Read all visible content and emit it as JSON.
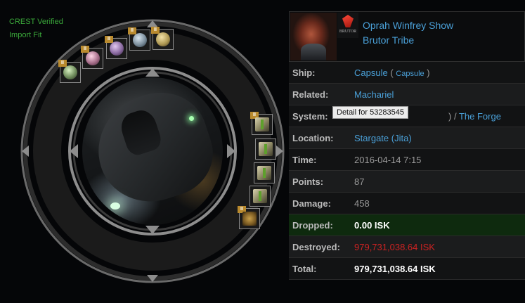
{
  "crest": {
    "verified": "CREST Verified",
    "import_fit": "Import Fit"
  },
  "victim": {
    "name": "Oprah Winfrey Show",
    "corp": "Brutor Tribe",
    "corp_logo_text": "BRUTOR"
  },
  "details": {
    "ship_label": "Ship:",
    "ship_name": "Capsule",
    "ship_group": "Capsule",
    "ship_group_open": " ( ",
    "ship_group_close": " )",
    "related_label": "Related:",
    "related_value": "Machariel",
    "system_label": "System:",
    "system_hidden_suffix": ")",
    "system_sep": " / ",
    "system_region": "The Forge",
    "location_label": "Location:",
    "location_value": "Stargate (Jita)",
    "time_label": "Time:",
    "time_value": "2016-04-14 7:15",
    "points_label": "Points:",
    "points_value": "87",
    "damage_label": "Damage:",
    "damage_value": "458",
    "dropped_label": "Dropped:",
    "dropped_value": "0.00 ISK",
    "destroyed_label": "Destroyed:",
    "destroyed_value": "979,731,038.64 ISK",
    "total_label": "Total:",
    "total_value": "979,731,038.64 ISK"
  },
  "tooltip": "Detail for 53283545",
  "slots": {
    "badge": "II",
    "implant_icons": [
      "implant-icon",
      "implant-icon",
      "implant-icon",
      "implant-icon",
      "implant-icon"
    ],
    "rig_icons": [
      "rig-icon",
      "rig-icon",
      "rig-icon",
      "rig-icon"
    ],
    "sub_icon": "subsystem-icon"
  },
  "colors": {
    "link": "#4aa0d8",
    "destroyed": "#cc2222",
    "dropped_bg": "#0e2a0e",
    "crest": "#3aa83a"
  }
}
